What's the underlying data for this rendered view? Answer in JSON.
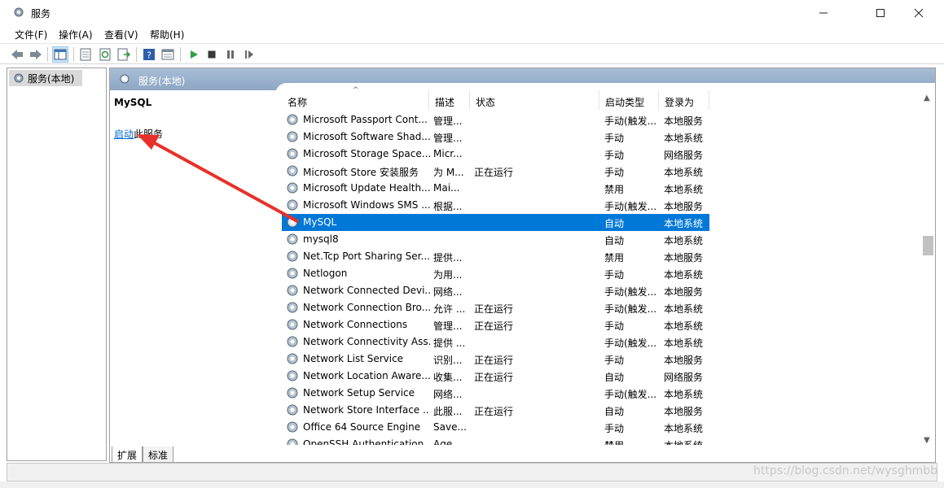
{
  "window": {
    "title": "服务",
    "minimize_icon": "minimize-icon",
    "maximize_icon": "maximize-icon",
    "close_icon": "close-icon"
  },
  "menu": [
    "文件(F)",
    "操作(A)",
    "查看(V)",
    "帮助(H)"
  ],
  "toolbar_icons": [
    "back-arrow-icon",
    "forward-arrow-icon",
    "show-hide-console-tree-icon",
    "properties-icon",
    "refresh-icon",
    "export-list-icon",
    "help-icon",
    "view-icon",
    "start-service-icon",
    "stop-service-icon",
    "pause-service-icon",
    "resume-service-icon"
  ],
  "tree": {
    "root_label": "服务(本地)"
  },
  "pane_header": "服务(本地)",
  "description": {
    "service_name": "MySQL",
    "action_link": "启动",
    "action_suffix": "此服务"
  },
  "columns": [
    "名称",
    "描述",
    "状态",
    "启动类型",
    "登录为"
  ],
  "services": [
    {
      "name": "Microsoft Passport Cont...",
      "desc": "管理...",
      "status": "",
      "startup": "手动(触发...",
      "logon": "本地服务"
    },
    {
      "name": "Microsoft Software Shad...",
      "desc": "管理...",
      "status": "",
      "startup": "手动",
      "logon": "本地系统"
    },
    {
      "name": "Microsoft Storage Space...",
      "desc": "Micr...",
      "status": "",
      "startup": "手动",
      "logon": "网络服务"
    },
    {
      "name": "Microsoft Store 安装服务",
      "desc": "为 M...",
      "status": "正在运行",
      "startup": "手动",
      "logon": "本地系统"
    },
    {
      "name": "Microsoft Update Health...",
      "desc": "Mai...",
      "status": "",
      "startup": "禁用",
      "logon": "本地系统"
    },
    {
      "name": "Microsoft Windows SMS ...",
      "desc": "根据...",
      "status": "",
      "startup": "手动(触发...",
      "logon": "本地服务"
    },
    {
      "name": "MySQL",
      "desc": "",
      "status": "",
      "startup": "自动",
      "logon": "本地系统",
      "selected": true
    },
    {
      "name": "mysql8",
      "desc": "",
      "status": "",
      "startup": "自动",
      "logon": "本地系统"
    },
    {
      "name": "Net.Tcp Port Sharing Ser...",
      "desc": "提供...",
      "status": "",
      "startup": "禁用",
      "logon": "本地服务"
    },
    {
      "name": "Netlogon",
      "desc": "为用...",
      "status": "",
      "startup": "手动",
      "logon": "本地系统"
    },
    {
      "name": "Network Connected Devi...",
      "desc": "网络...",
      "status": "",
      "startup": "手动(触发...",
      "logon": "本地服务"
    },
    {
      "name": "Network Connection Bro...",
      "desc": "允许 ...",
      "status": "正在运行",
      "startup": "手动(触发...",
      "logon": "本地系统"
    },
    {
      "name": "Network Connections",
      "desc": "管理...",
      "status": "正在运行",
      "startup": "手动",
      "logon": "本地系统"
    },
    {
      "name": "Network Connectivity Ass...",
      "desc": "提供 ...",
      "status": "",
      "startup": "手动(触发...",
      "logon": "本地系统"
    },
    {
      "name": "Network List Service",
      "desc": "识别...",
      "status": "正在运行",
      "startup": "手动",
      "logon": "本地服务"
    },
    {
      "name": "Network Location Aware...",
      "desc": "收集...",
      "status": "正在运行",
      "startup": "自动",
      "logon": "网络服务"
    },
    {
      "name": "Network Setup Service",
      "desc": "网络...",
      "status": "",
      "startup": "手动(触发...",
      "logon": "本地系统"
    },
    {
      "name": "Network Store Interface ...",
      "desc": "此服...",
      "status": "正在运行",
      "startup": "自动",
      "logon": "本地服务"
    },
    {
      "name": "Office 64 Source Engine",
      "desc": "Save...",
      "status": "",
      "startup": "手动",
      "logon": "本地系统"
    },
    {
      "name": "OpenSSH Authentication ...",
      "desc": "Age...",
      "status": "",
      "startup": "禁用",
      "logon": "本地系统"
    }
  ],
  "tabs": [
    "扩展",
    "标准"
  ],
  "watermark": "https://blog.csdn.net/wysghmbb",
  "colors": {
    "selection": "#0078d7",
    "link": "#0066cc",
    "arrow": "#e8302a",
    "header": "#9fb6d1"
  }
}
